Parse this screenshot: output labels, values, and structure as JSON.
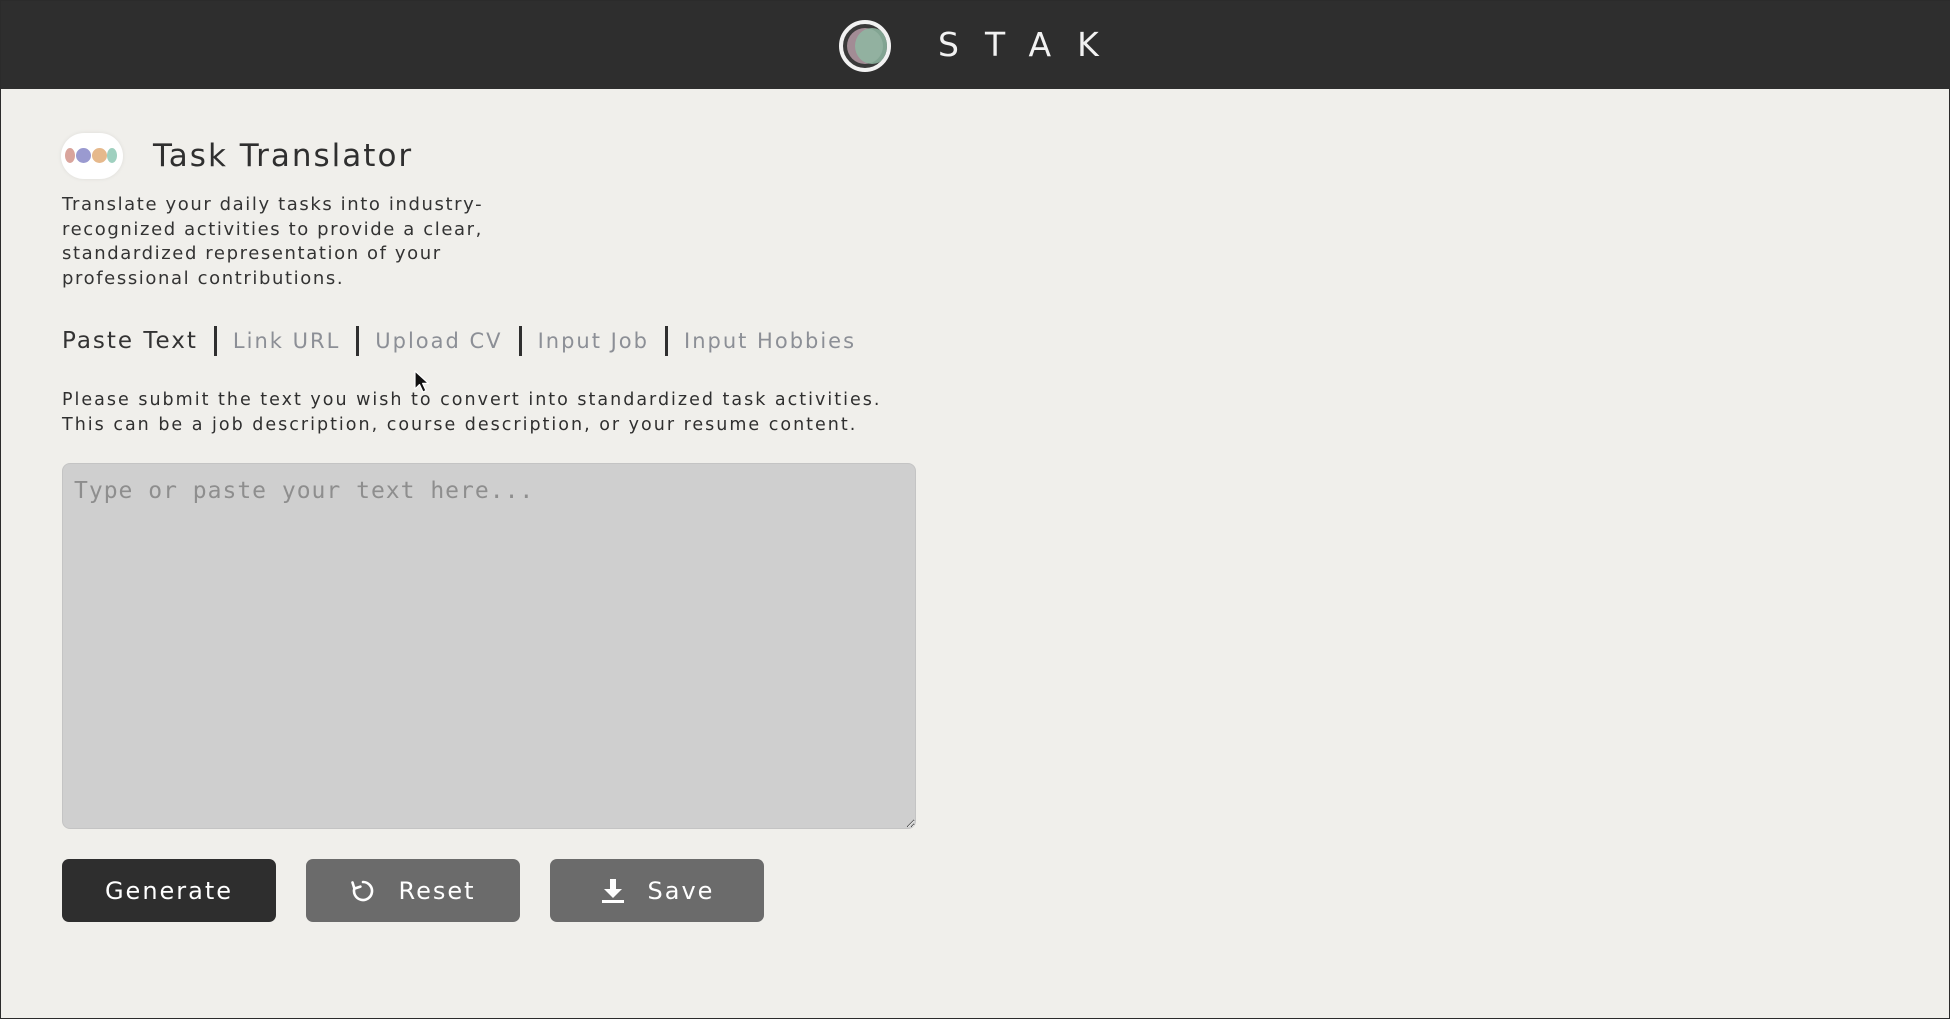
{
  "header": {
    "brand": "STAK"
  },
  "page": {
    "title": "Task Translator",
    "description": "Translate your daily tasks into industry-recognized activities to provide a clear, standardized representation of your professional contributions."
  },
  "tabs": [
    {
      "label": "Paste Text",
      "active": true
    },
    {
      "label": "Link URL",
      "active": false
    },
    {
      "label": "Upload CV",
      "active": false
    },
    {
      "label": "Input Job",
      "active": false
    },
    {
      "label": "Input Hobbies",
      "active": false
    }
  ],
  "instructions": {
    "line1": "Please submit the text you wish to convert into standardized task activities.",
    "line2": "This can be a job description, course description, or your resume content."
  },
  "input": {
    "value": "",
    "placeholder": "Type or paste your text here..."
  },
  "buttons": {
    "generate": "Generate",
    "reset": "Reset",
    "save": "Save"
  },
  "icons": {
    "brand": "stak-logo-icon",
    "app": "task-translator-icon",
    "reset": "refresh-icon",
    "save": "download-icon"
  },
  "colors": {
    "topbar": "#2e2e2e",
    "background": "#f0efeb",
    "primary_button": "#2e2e2e",
    "secondary_button": "#6b6b6b",
    "textarea": "#cfcfcf",
    "tab_inactive": "#8c8f96"
  }
}
